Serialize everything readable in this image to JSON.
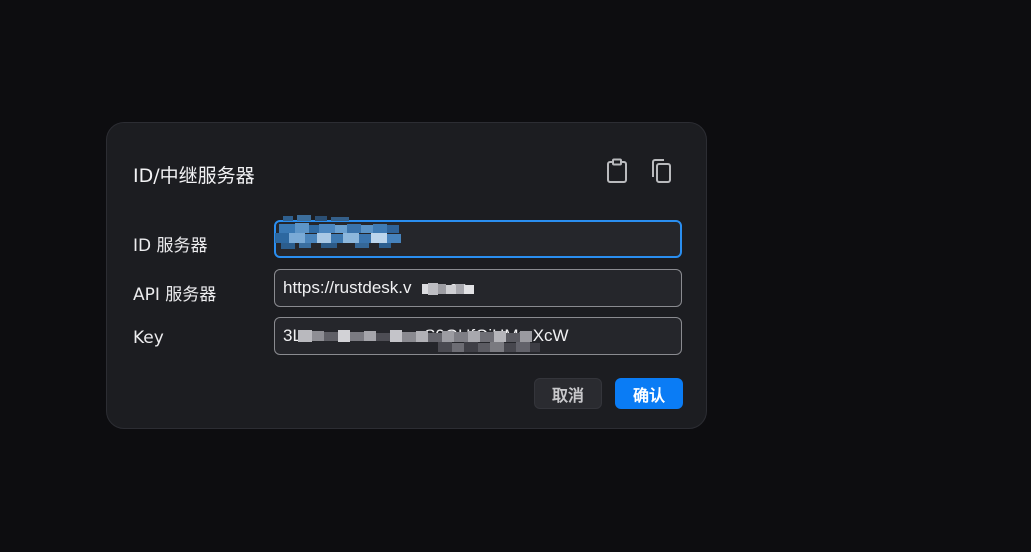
{
  "dialog": {
    "title": "ID/中继服务器",
    "icons": {
      "paste": "clipboard-paste-icon",
      "copy": "copy-icon"
    },
    "fields": {
      "id_server": {
        "label": "ID 服务器",
        "value": ""
      },
      "api_server": {
        "label": "API 服务器",
        "value": "https://rustdesk.v        cn"
      },
      "key": {
        "label": "Key",
        "value": "3L                          S0GUfOiHMmXcW"
      }
    },
    "buttons": {
      "cancel": "取消",
      "ok": "确认"
    }
  },
  "colors": {
    "accent": "#0a7cf5",
    "focus_border": "#2a8ef0",
    "dialog_bg": "#1c1d21",
    "page_bg": "#0d0d10"
  }
}
